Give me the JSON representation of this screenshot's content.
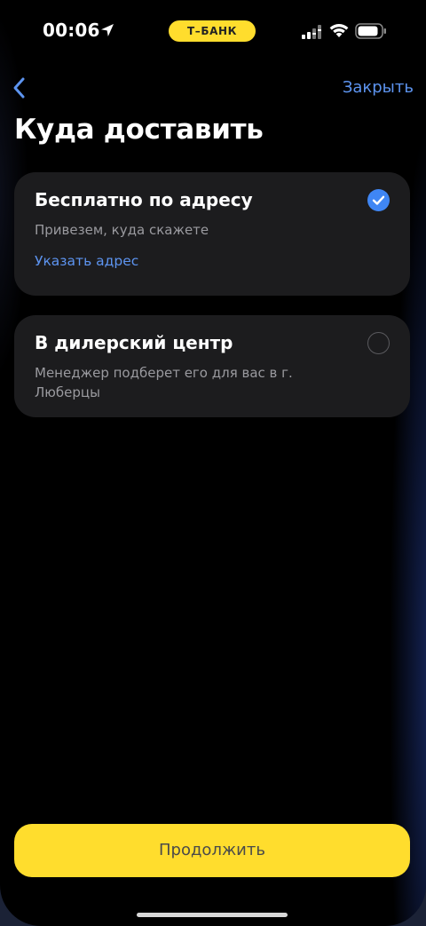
{
  "status_bar": {
    "time": "00:06",
    "carrier_badge": "Т–БАНК",
    "icons": [
      "location-arrow-icon",
      "signal-icon",
      "wifi-icon",
      "battery-icon"
    ]
  },
  "nav": {
    "back_icon": "chevron-left-icon",
    "close_label": "Закрыть"
  },
  "title": "Куда доставить",
  "options": [
    {
      "title": "Бесплатно по адресу",
      "subtitle": "Привезем, куда скажете",
      "link": "Указать адрес",
      "selected": true
    },
    {
      "title": "В дилерский центр",
      "subtitle": "Менеджер подберет его для вас в г. Люберцы",
      "selected": false
    }
  ],
  "continue_label": "Продолжить",
  "colors": {
    "background": "#000000",
    "card": "#1c1c1e",
    "accent_blue": "#5d94f0",
    "radio_blue": "#3f86f4",
    "brand_yellow": "#ffdd2d"
  }
}
